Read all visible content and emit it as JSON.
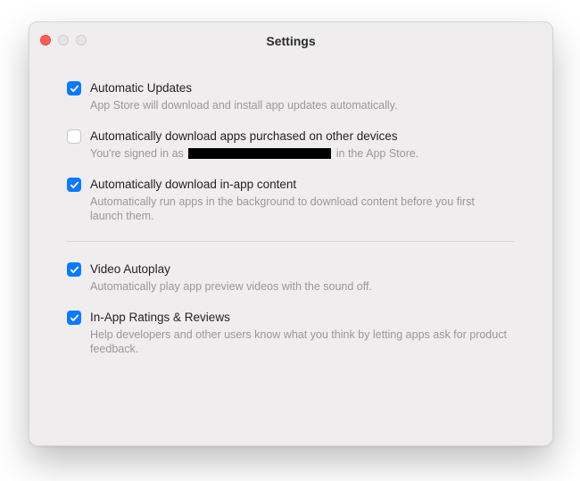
{
  "window": {
    "title": "Settings"
  },
  "colors": {
    "accent": "#0a7aff"
  },
  "groups": {
    "g1": {
      "auto_updates": {
        "checked": true,
        "label": "Automatic Updates",
        "desc": "App Store will download and install app updates automatically."
      },
      "download_purchased": {
        "checked": false,
        "label": "Automatically download apps purchased on other devices",
        "desc_prefix": "You're signed in as ",
        "desc_suffix": " in the App Store.",
        "redacted": true
      },
      "download_inapp": {
        "checked": true,
        "label": "Automatically download in-app content",
        "desc": "Automatically run apps in the background to download content before you first launch them."
      }
    },
    "g2": {
      "video_autoplay": {
        "checked": true,
        "label": "Video Autoplay",
        "desc": "Automatically play app preview videos with the sound off."
      },
      "ratings_reviews": {
        "checked": true,
        "label": "In-App Ratings & Reviews",
        "desc": "Help developers and other users know what you think by letting apps ask for product feedback."
      }
    }
  }
}
